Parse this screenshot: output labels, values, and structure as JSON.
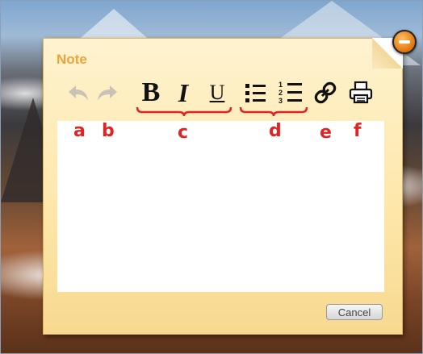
{
  "note": {
    "title": "Note",
    "cancel_label": "Cancel",
    "body_text": ""
  },
  "toolbar": {
    "undo_icon": "undo-arrow-icon",
    "redo_icon": "redo-arrow-icon",
    "bold_label": "B",
    "italic_label": "I",
    "underline_label": "U",
    "bullet_list_icon": "bullet-list-icon",
    "numbered_list_icon": "numbered-list-icon",
    "numbered_list_digits": [
      "1",
      "2",
      "3"
    ],
    "link_icon": "link-icon",
    "print_icon": "print-icon"
  },
  "callouts": {
    "a": "a",
    "b": "b",
    "c": "c",
    "d": "d",
    "e": "e",
    "f": "f"
  },
  "colors": {
    "title": "#f0a33a",
    "callout": "#e12323",
    "note_bg": "#fde6a8",
    "close_button": "#e67e14"
  }
}
